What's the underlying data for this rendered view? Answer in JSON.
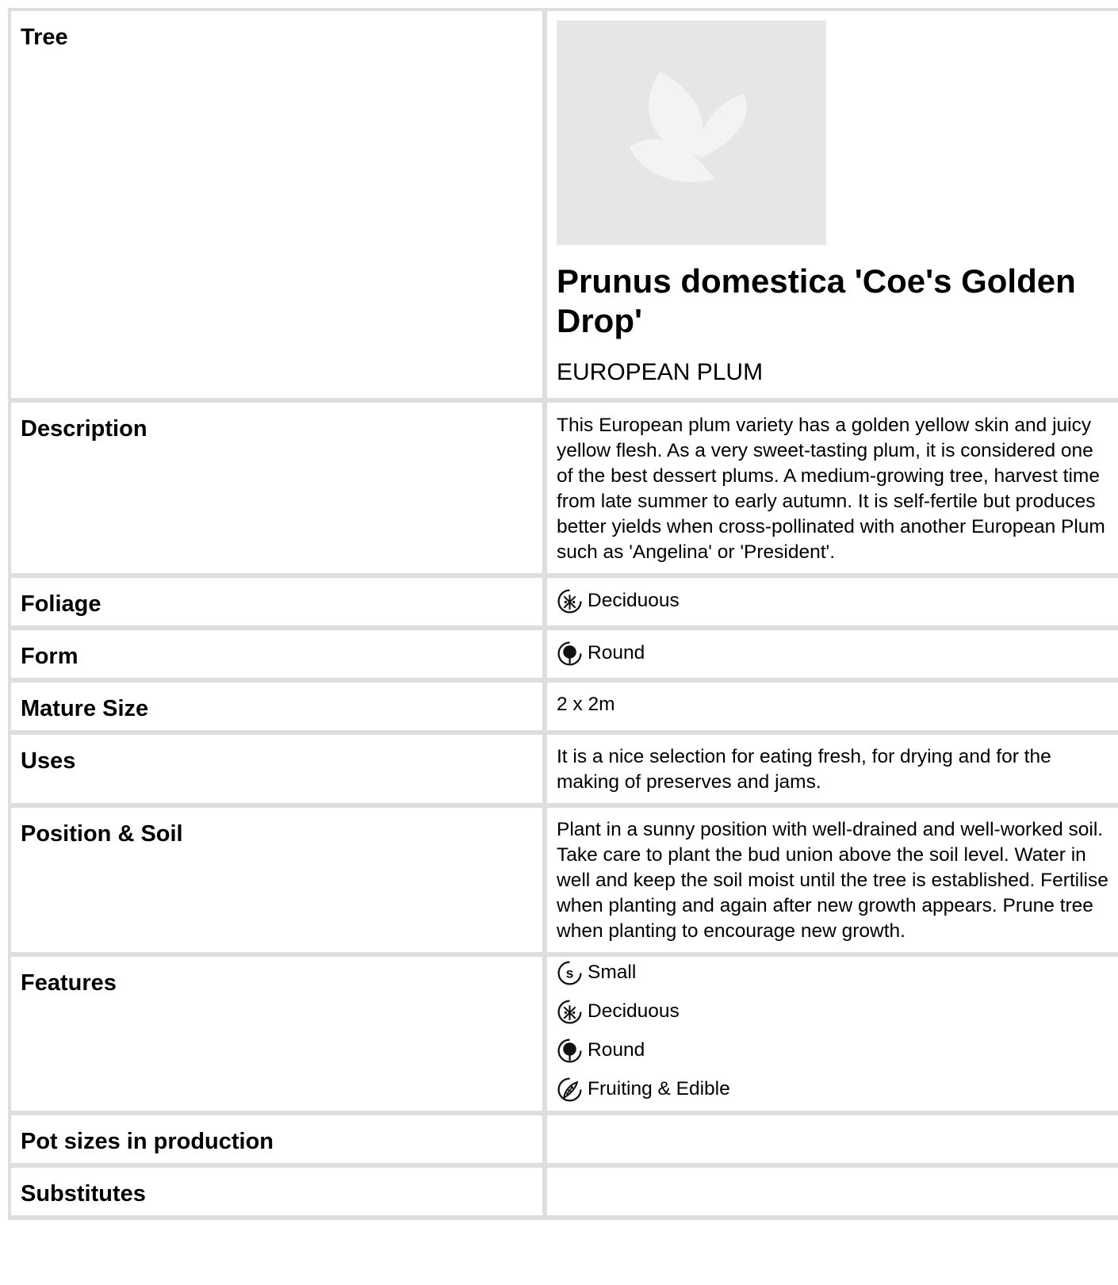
{
  "tree": {
    "label": "Tree",
    "image_icon": "leaf-placeholder-icon",
    "botanical_name": "Prunus domestica 'Coe's Golden Drop'",
    "common_name": "EUROPEAN PLUM"
  },
  "description": {
    "label": "Description",
    "text": "This European plum variety has a golden yellow skin and juicy yellow flesh. As a very sweet-tasting plum, it is considered one of the best dessert plums. A medium-growing tree, harvest time from late summer to early autumn. It is self-fertile but produces better yields when cross-pollinated with another European Plum such as 'Angelina' or 'President'."
  },
  "foliage": {
    "label": "Foliage",
    "value": "Deciduous",
    "icon": "deciduous-icon"
  },
  "form": {
    "label": "Form",
    "value": "Round",
    "icon": "round-form-icon"
  },
  "mature_size": {
    "label": "Mature Size",
    "value": "2 x 2m"
  },
  "uses": {
    "label": "Uses",
    "text": "It is a nice selection for eating fresh, for drying and for the making of preserves and jams."
  },
  "position_soil": {
    "label": "Position & Soil",
    "text": "Plant in a sunny position with well-drained and well-worked soil. Take care to plant the bud union above the soil level. Water in well and keep the soil moist until the tree is established. Fertilise when planting and again after new growth appears. Prune tree when planting to encourage new growth."
  },
  "features": {
    "label": "Features",
    "items": [
      {
        "label": "Small",
        "icon": "small-size-icon"
      },
      {
        "label": "Deciduous",
        "icon": "deciduous-icon"
      },
      {
        "label": "Round",
        "icon": "round-form-icon"
      },
      {
        "label": "Fruiting & Edible",
        "icon": "fruiting-edible-icon"
      }
    ]
  },
  "pot_sizes": {
    "label": "Pot sizes in production",
    "value": ""
  },
  "substitutes": {
    "label": "Substitutes",
    "value": ""
  }
}
